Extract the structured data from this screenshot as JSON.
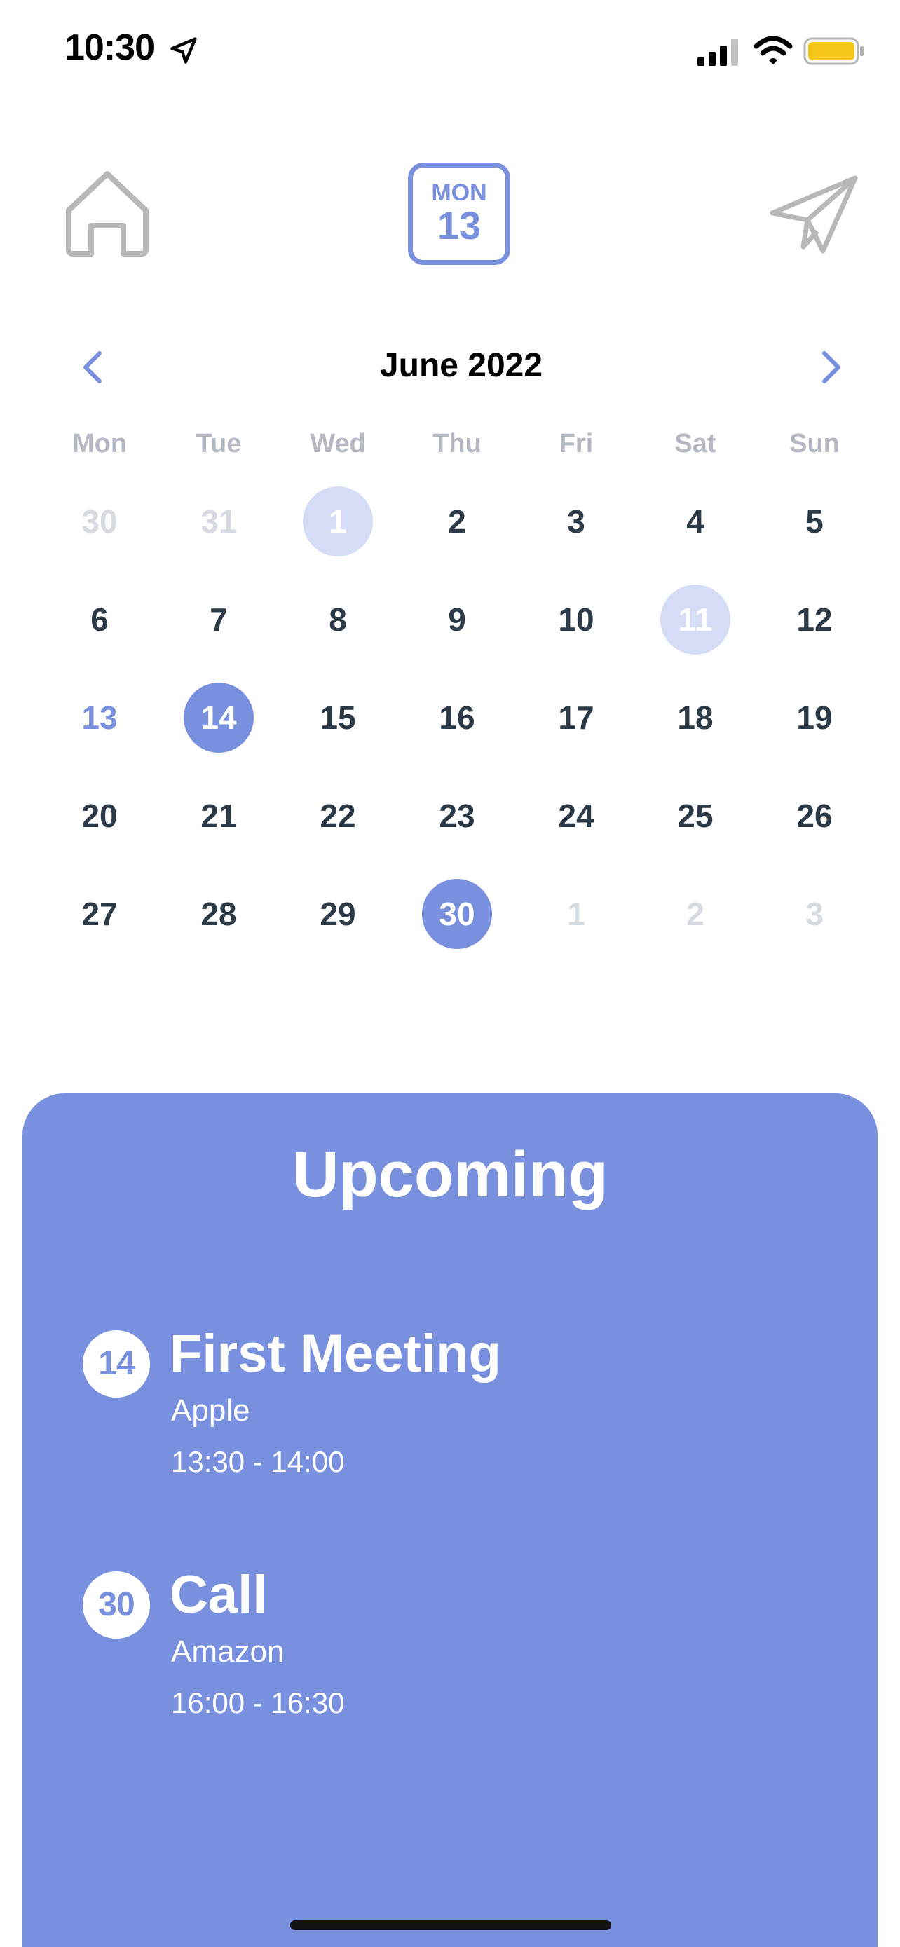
{
  "status_bar": {
    "time": "10:30",
    "battery_color": "#f5c51a"
  },
  "header": {
    "badge_day": "MON",
    "badge_date": "13",
    "home_icon": "home-icon",
    "send_icon": "paper-plane-icon"
  },
  "calendar": {
    "month_title": "June 2022",
    "weekdays": [
      "Mon",
      "Tue",
      "Wed",
      "Thu",
      "Fri",
      "Sat",
      "Sun"
    ],
    "weeks": [
      [
        {
          "d": "30",
          "state": "other"
        },
        {
          "d": "31",
          "state": "other"
        },
        {
          "d": "1",
          "state": "soft"
        },
        {
          "d": "2",
          "state": "normal"
        },
        {
          "d": "3",
          "state": "normal"
        },
        {
          "d": "4",
          "state": "normal"
        },
        {
          "d": "5",
          "state": "normal"
        }
      ],
      [
        {
          "d": "6",
          "state": "normal"
        },
        {
          "d": "7",
          "state": "normal"
        },
        {
          "d": "8",
          "state": "normal"
        },
        {
          "d": "9",
          "state": "normal"
        },
        {
          "d": "10",
          "state": "normal"
        },
        {
          "d": "11",
          "state": "soft"
        },
        {
          "d": "12",
          "state": "normal"
        }
      ],
      [
        {
          "d": "13",
          "state": "today"
        },
        {
          "d": "14",
          "state": "strong"
        },
        {
          "d": "15",
          "state": "normal"
        },
        {
          "d": "16",
          "state": "normal"
        },
        {
          "d": "17",
          "state": "normal"
        },
        {
          "d": "18",
          "state": "normal"
        },
        {
          "d": "19",
          "state": "normal"
        }
      ],
      [
        {
          "d": "20",
          "state": "normal"
        },
        {
          "d": "21",
          "state": "normal"
        },
        {
          "d": "22",
          "state": "normal"
        },
        {
          "d": "23",
          "state": "normal"
        },
        {
          "d": "24",
          "state": "normal"
        },
        {
          "d": "25",
          "state": "normal"
        },
        {
          "d": "26",
          "state": "normal"
        }
      ],
      [
        {
          "d": "27",
          "state": "normal"
        },
        {
          "d": "28",
          "state": "normal"
        },
        {
          "d": "29",
          "state": "normal"
        },
        {
          "d": "30",
          "state": "strong"
        },
        {
          "d": "1",
          "state": "other"
        },
        {
          "d": "2",
          "state": "other"
        },
        {
          "d": "3",
          "state": "other"
        }
      ]
    ]
  },
  "upcoming": {
    "title": "Upcoming",
    "events": [
      {
        "day": "14",
        "title": "First Meeting",
        "company": "Apple",
        "time": "13:30 - 14:00"
      },
      {
        "day": "30",
        "title": "Call",
        "company": "Amazon",
        "time": "16:00 - 16:30"
      }
    ]
  },
  "colors": {
    "accent": "#7890dd",
    "accent_soft": "#d5ddf6",
    "day_text": "#2c3a47",
    "muted": "#b3b8c2",
    "icon_gray": "#b8b8b8"
  }
}
